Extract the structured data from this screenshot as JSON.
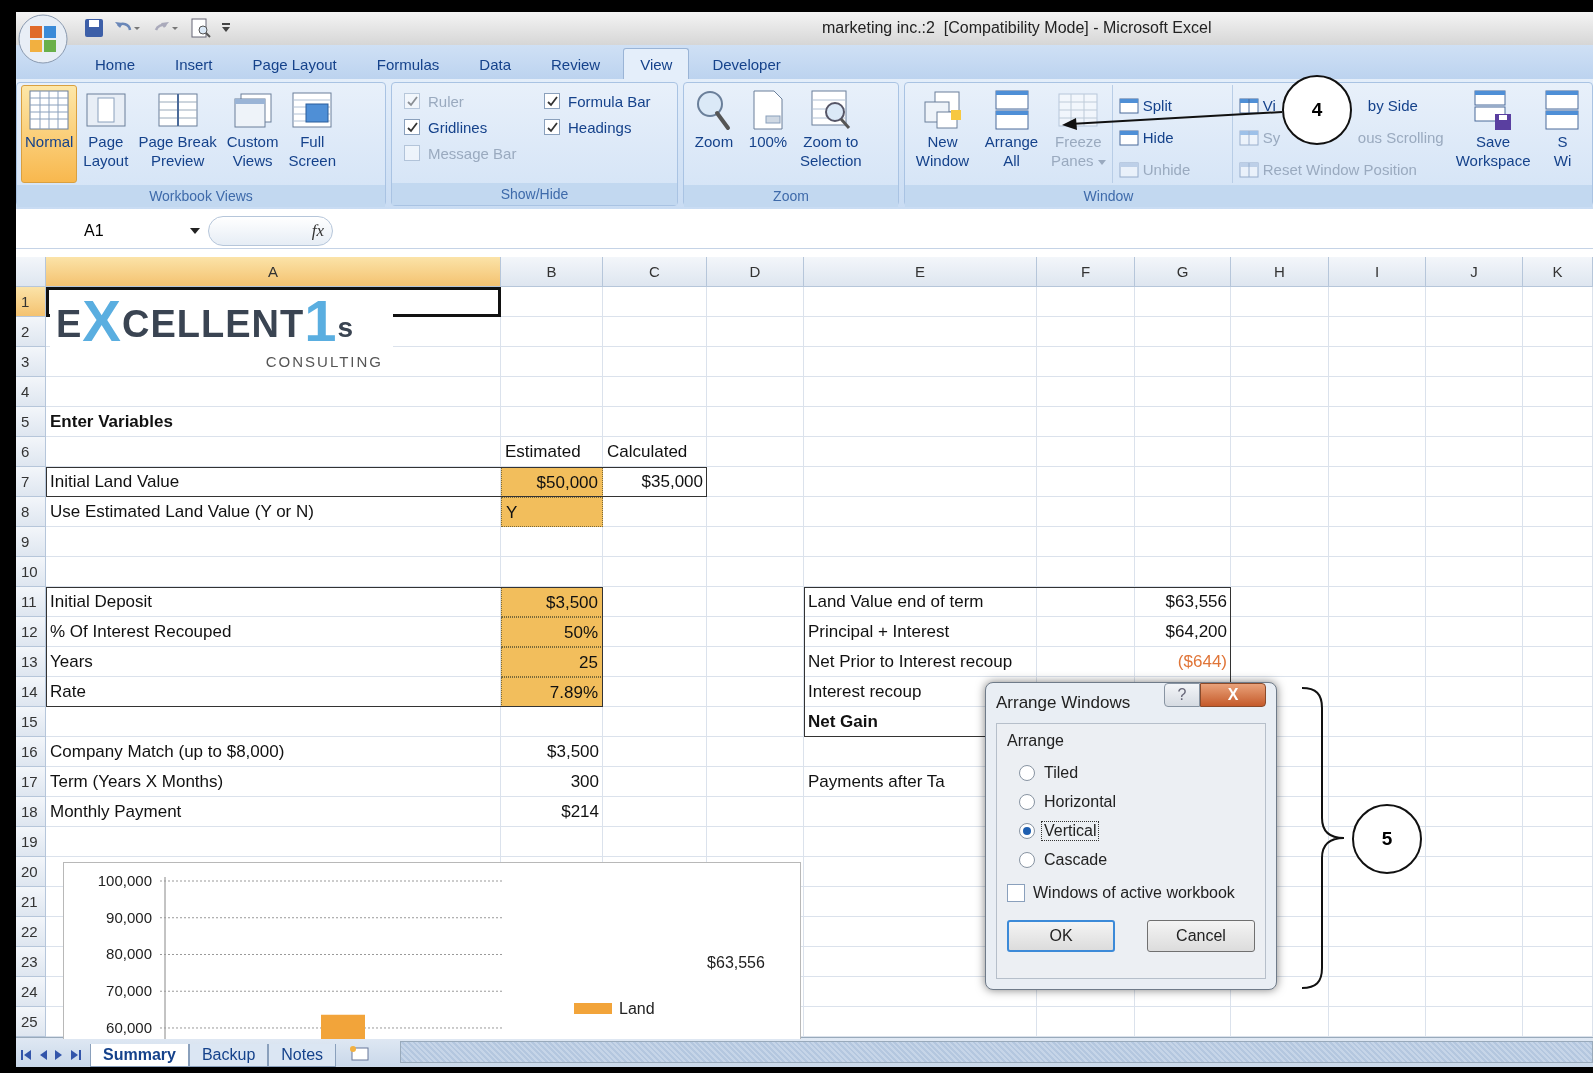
{
  "window": {
    "title": "marketing inc.:2  [Compatibility Mode] - Microsoft Excel"
  },
  "ribbon_tabs": [
    {
      "label": "Home",
      "selected": false
    },
    {
      "label": "Insert",
      "selected": false
    },
    {
      "label": "Page Layout",
      "selected": false
    },
    {
      "label": "Formulas",
      "selected": false
    },
    {
      "label": "Data",
      "selected": false
    },
    {
      "label": "Review",
      "selected": false
    },
    {
      "label": "View",
      "selected": true
    },
    {
      "label": "Developer",
      "selected": false
    }
  ],
  "ribbon_groups": [
    {
      "title": "Workbook Views",
      "items": [
        {
          "kind": "large",
          "lines": [
            "Normal"
          ],
          "selected": true
        },
        {
          "kind": "large",
          "lines": [
            "Page",
            "Layout"
          ],
          "selected": false
        },
        {
          "kind": "large",
          "lines": [
            "Page Break",
            "Preview"
          ],
          "selected": false
        },
        {
          "kind": "large",
          "lines": [
            "Custom",
            "Views"
          ],
          "selected": false
        },
        {
          "kind": "large",
          "lines": [
            "Full",
            "Screen"
          ],
          "selected": false
        }
      ]
    },
    {
      "title": "Show/Hide",
      "items": [
        {
          "kind": "checks",
          "checks": [
            {
              "label": "Ruler",
              "checked": true,
              "disabled": true
            },
            {
              "label": "Formula Bar",
              "checked": true,
              "disabled": false
            },
            {
              "label": "Gridlines",
              "checked": true,
              "disabled": false
            },
            {
              "label": "Headings",
              "checked": true,
              "disabled": false
            },
            {
              "label": "Message Bar",
              "checked": false,
              "disabled": true
            }
          ]
        }
      ]
    },
    {
      "title": "Zoom",
      "items": [
        {
          "kind": "large",
          "lines": [
            "Zoom"
          ]
        },
        {
          "kind": "large",
          "lines": [
            "100%"
          ]
        },
        {
          "kind": "large",
          "lines": [
            "Zoom to",
            "Selection"
          ]
        }
      ]
    },
    {
      "title": "Window",
      "items": [
        {
          "kind": "large",
          "lines": [
            "New",
            "Window"
          ],
          "disabled": false
        },
        {
          "kind": "large",
          "lines": [
            "Arrange",
            "All"
          ],
          "disabled": false
        },
        {
          "kind": "large",
          "lines": [
            "Freeze",
            "Panes"
          ],
          "disabled": true,
          "dropdown": true
        },
        {
          "kind": "stack",
          "entries": [
            {
              "parts": [
                "Split"
              ],
              "disabled": false
            },
            {
              "parts": [
                "Hide"
              ],
              "disabled": false
            },
            {
              "parts": [
                "Unhide"
              ],
              "disabled": true
            }
          ]
        },
        {
          "kind": "stack",
          "entries": [
            {
              "parts": [
                "Vi",
                "by Side"
              ],
              "disabled": false
            },
            {
              "parts": [
                "Sy",
                "ous Scrolling"
              ],
              "disabled": true
            },
            {
              "parts": [
                "Reset Window Position"
              ],
              "disabled": true
            }
          ]
        },
        {
          "kind": "large",
          "lines": [
            "Save",
            "Workspace"
          ],
          "disabled": false
        },
        {
          "kind": "large",
          "lines": [
            "S",
            "Wi"
          ],
          "disabled": false
        }
      ]
    }
  ],
  "formula_bar": {
    "name_box": "A1",
    "function_label": "fx"
  },
  "sheet": {
    "columns": [
      {
        "label": "A",
        "selected": true
      },
      {
        "label": "B",
        "selected": false
      },
      {
        "label": "C",
        "selected": false
      },
      {
        "label": "D",
        "selected": false
      },
      {
        "label": "E",
        "selected": false
      },
      {
        "label": "F",
        "selected": false
      },
      {
        "label": "G",
        "selected": false
      },
      {
        "label": "H",
        "selected": false
      },
      {
        "label": "I",
        "selected": false
      },
      {
        "label": "J",
        "selected": false
      },
      {
        "label": "K",
        "selected": false
      }
    ],
    "rows": [
      {
        "label": "1",
        "selected": true
      },
      {
        "label": "2",
        "selected": false
      },
      {
        "label": "3",
        "selected": false
      },
      {
        "label": "4",
        "selected": false
      },
      {
        "label": "5",
        "selected": false,
        "cells": [
          {
            "text": "Enter Variables",
            "kind": "heading"
          }
        ]
      },
      {
        "label": "6",
        "selected": false,
        "cells": [
          null,
          {
            "text": "Estimated",
            "kind": "text"
          },
          {
            "text": "Calculated",
            "kind": "text"
          }
        ]
      },
      {
        "label": "7",
        "selected": false,
        "cells": [
          {
            "text": "Initial Land Value",
            "kind": "text"
          },
          {
            "text": "$50,000",
            "kind": "input"
          },
          {
            "text": "$35,000",
            "kind": "number"
          }
        ]
      },
      {
        "label": "8",
        "selected": false,
        "cells": [
          {
            "text": "Use Estimated Land Value (Y or N)",
            "kind": "text"
          },
          {
            "text": "Y",
            "kind": "input-text"
          }
        ]
      },
      {
        "label": "9",
        "selected": false
      },
      {
        "label": "10",
        "selected": false
      },
      {
        "label": "11",
        "selected": false,
        "cells": [
          {
            "text": "Initial Deposit",
            "kind": "text"
          },
          {
            "text": "$3,500",
            "kind": "input"
          },
          null,
          null,
          {
            "text": "Land Value end of term",
            "kind": "text"
          },
          null,
          {
            "text": "$63,556",
            "kind": "number"
          }
        ]
      },
      {
        "label": "12",
        "selected": false,
        "cells": [
          {
            "text": "% Of Interest Recouped",
            "kind": "text"
          },
          {
            "text": "50%",
            "kind": "input"
          },
          null,
          null,
          {
            "text": "Principal + Interest",
            "kind": "text"
          },
          null,
          {
            "text": "$64,200",
            "kind": "number"
          }
        ]
      },
      {
        "label": "13",
        "selected": false,
        "cells": [
          {
            "text": "Years",
            "kind": "text"
          },
          {
            "text": "25",
            "kind": "input"
          },
          null,
          null,
          {
            "text": "Net Prior to Interest recoup",
            "kind": "text"
          },
          null,
          {
            "text": "($644)",
            "kind": "negative"
          }
        ]
      },
      {
        "label": "14",
        "selected": false,
        "cells": [
          {
            "text": "Rate",
            "kind": "text"
          },
          {
            "text": "7.89%",
            "kind": "input"
          },
          null,
          null,
          {
            "text": "Interest recoup",
            "kind": "text"
          }
        ]
      },
      {
        "label": "15",
        "selected": false,
        "cells": [
          null,
          null,
          null,
          null,
          {
            "text": "Net Gain",
            "kind": "heading"
          }
        ]
      },
      {
        "label": "16",
        "selected": false,
        "cells": [
          {
            "text": "Company Match (up to $8,000)",
            "kind": "text"
          },
          {
            "text": "$3,500",
            "kind": "number"
          }
        ]
      },
      {
        "label": "17",
        "selected": false,
        "cells": [
          {
            "text": "Term (Years X Months)",
            "kind": "text"
          },
          {
            "text": "300",
            "kind": "number"
          },
          null,
          null,
          {
            "text": "Payments after Ta",
            "kind": "text"
          }
        ]
      },
      {
        "label": "18",
        "selected": false,
        "cells": [
          {
            "text": "Monthly Payment",
            "kind": "text"
          },
          {
            "text": "$214",
            "kind": "number"
          }
        ]
      },
      {
        "label": "19",
        "selected": false
      },
      {
        "label": "20",
        "selected": false
      },
      {
        "label": "21",
        "selected": false
      },
      {
        "label": "22",
        "selected": false
      },
      {
        "label": "23",
        "selected": false
      },
      {
        "label": "24",
        "selected": false
      },
      {
        "label": "25",
        "selected": false
      }
    ]
  },
  "logo": {
    "parts": [
      "E",
      "X",
      "CELLENT",
      "1",
      "s"
    ],
    "tagline": "CONSULTING"
  },
  "chart": {
    "chart_data": {
      "type": "bar",
      "ylim": [
        57000,
        100000
      ],
      "grid": true,
      "yticks": [
        {
          "value": 60000,
          "label": "60,000"
        },
        {
          "value": 70000,
          "label": "70,000"
        },
        {
          "value": 80000,
          "label": "80,000"
        },
        {
          "value": 90000,
          "label": "90,000"
        },
        {
          "value": 100000,
          "label": "100,000"
        }
      ],
      "series": [
        {
          "name": "Land",
          "color": "#f2a43a",
          "values": [
            63600
          ]
        }
      ],
      "annotations": [
        "$63,556"
      ]
    }
  },
  "sheet_tabs": [
    {
      "label": "Summary",
      "selected": true
    },
    {
      "label": "Backup",
      "selected": false
    },
    {
      "label": "Notes",
      "selected": false
    }
  ],
  "dialog": {
    "title": "Arrange Windows",
    "help_label": "?",
    "close_label": "X",
    "group_label": "Arrange",
    "options": [
      {
        "label": "Tiled",
        "selected": false,
        "focused": false
      },
      {
        "label": "Horizontal",
        "selected": false,
        "focused": false
      },
      {
        "label": "Vertical",
        "selected": true,
        "focused": true
      },
      {
        "label": "Cascade",
        "selected": false,
        "focused": false
      }
    ],
    "checkbox": {
      "label": "Windows of active workbook",
      "checked": false
    },
    "buttons": [
      {
        "label": "OK",
        "default": true
      },
      {
        "label": "Cancel",
        "default": false
      }
    ]
  },
  "callouts": [
    {
      "label": "4",
      "kind": "arrow"
    },
    {
      "label": "5",
      "kind": "brace"
    }
  ]
}
